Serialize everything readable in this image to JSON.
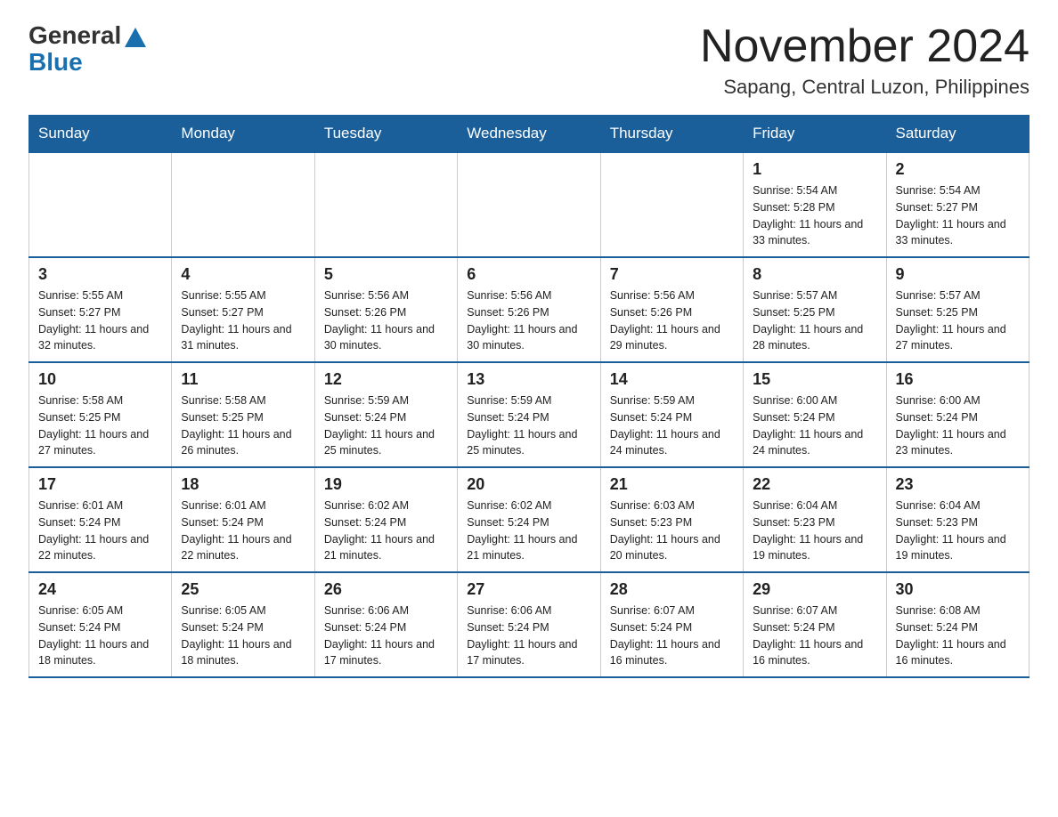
{
  "logo": {
    "general": "General",
    "blue": "Blue"
  },
  "header": {
    "month_year": "November 2024",
    "location": "Sapang, Central Luzon, Philippines"
  },
  "weekdays": [
    "Sunday",
    "Monday",
    "Tuesday",
    "Wednesday",
    "Thursday",
    "Friday",
    "Saturday"
  ],
  "weeks": [
    [
      {
        "day": "",
        "info": ""
      },
      {
        "day": "",
        "info": ""
      },
      {
        "day": "",
        "info": ""
      },
      {
        "day": "",
        "info": ""
      },
      {
        "day": "",
        "info": ""
      },
      {
        "day": "1",
        "info": "Sunrise: 5:54 AM\nSunset: 5:28 PM\nDaylight: 11 hours and 33 minutes."
      },
      {
        "day": "2",
        "info": "Sunrise: 5:54 AM\nSunset: 5:27 PM\nDaylight: 11 hours and 33 minutes."
      }
    ],
    [
      {
        "day": "3",
        "info": "Sunrise: 5:55 AM\nSunset: 5:27 PM\nDaylight: 11 hours and 32 minutes."
      },
      {
        "day": "4",
        "info": "Sunrise: 5:55 AM\nSunset: 5:27 PM\nDaylight: 11 hours and 31 minutes."
      },
      {
        "day": "5",
        "info": "Sunrise: 5:56 AM\nSunset: 5:26 PM\nDaylight: 11 hours and 30 minutes."
      },
      {
        "day": "6",
        "info": "Sunrise: 5:56 AM\nSunset: 5:26 PM\nDaylight: 11 hours and 30 minutes."
      },
      {
        "day": "7",
        "info": "Sunrise: 5:56 AM\nSunset: 5:26 PM\nDaylight: 11 hours and 29 minutes."
      },
      {
        "day": "8",
        "info": "Sunrise: 5:57 AM\nSunset: 5:25 PM\nDaylight: 11 hours and 28 minutes."
      },
      {
        "day": "9",
        "info": "Sunrise: 5:57 AM\nSunset: 5:25 PM\nDaylight: 11 hours and 27 minutes."
      }
    ],
    [
      {
        "day": "10",
        "info": "Sunrise: 5:58 AM\nSunset: 5:25 PM\nDaylight: 11 hours and 27 minutes."
      },
      {
        "day": "11",
        "info": "Sunrise: 5:58 AM\nSunset: 5:25 PM\nDaylight: 11 hours and 26 minutes."
      },
      {
        "day": "12",
        "info": "Sunrise: 5:59 AM\nSunset: 5:24 PM\nDaylight: 11 hours and 25 minutes."
      },
      {
        "day": "13",
        "info": "Sunrise: 5:59 AM\nSunset: 5:24 PM\nDaylight: 11 hours and 25 minutes."
      },
      {
        "day": "14",
        "info": "Sunrise: 5:59 AM\nSunset: 5:24 PM\nDaylight: 11 hours and 24 minutes."
      },
      {
        "day": "15",
        "info": "Sunrise: 6:00 AM\nSunset: 5:24 PM\nDaylight: 11 hours and 24 minutes."
      },
      {
        "day": "16",
        "info": "Sunrise: 6:00 AM\nSunset: 5:24 PM\nDaylight: 11 hours and 23 minutes."
      }
    ],
    [
      {
        "day": "17",
        "info": "Sunrise: 6:01 AM\nSunset: 5:24 PM\nDaylight: 11 hours and 22 minutes."
      },
      {
        "day": "18",
        "info": "Sunrise: 6:01 AM\nSunset: 5:24 PM\nDaylight: 11 hours and 22 minutes."
      },
      {
        "day": "19",
        "info": "Sunrise: 6:02 AM\nSunset: 5:24 PM\nDaylight: 11 hours and 21 minutes."
      },
      {
        "day": "20",
        "info": "Sunrise: 6:02 AM\nSunset: 5:24 PM\nDaylight: 11 hours and 21 minutes."
      },
      {
        "day": "21",
        "info": "Sunrise: 6:03 AM\nSunset: 5:23 PM\nDaylight: 11 hours and 20 minutes."
      },
      {
        "day": "22",
        "info": "Sunrise: 6:04 AM\nSunset: 5:23 PM\nDaylight: 11 hours and 19 minutes."
      },
      {
        "day": "23",
        "info": "Sunrise: 6:04 AM\nSunset: 5:23 PM\nDaylight: 11 hours and 19 minutes."
      }
    ],
    [
      {
        "day": "24",
        "info": "Sunrise: 6:05 AM\nSunset: 5:24 PM\nDaylight: 11 hours and 18 minutes."
      },
      {
        "day": "25",
        "info": "Sunrise: 6:05 AM\nSunset: 5:24 PM\nDaylight: 11 hours and 18 minutes."
      },
      {
        "day": "26",
        "info": "Sunrise: 6:06 AM\nSunset: 5:24 PM\nDaylight: 11 hours and 17 minutes."
      },
      {
        "day": "27",
        "info": "Sunrise: 6:06 AM\nSunset: 5:24 PM\nDaylight: 11 hours and 17 minutes."
      },
      {
        "day": "28",
        "info": "Sunrise: 6:07 AM\nSunset: 5:24 PM\nDaylight: 11 hours and 16 minutes."
      },
      {
        "day": "29",
        "info": "Sunrise: 6:07 AM\nSunset: 5:24 PM\nDaylight: 11 hours and 16 minutes."
      },
      {
        "day": "30",
        "info": "Sunrise: 6:08 AM\nSunset: 5:24 PM\nDaylight: 11 hours and 16 minutes."
      }
    ]
  ]
}
